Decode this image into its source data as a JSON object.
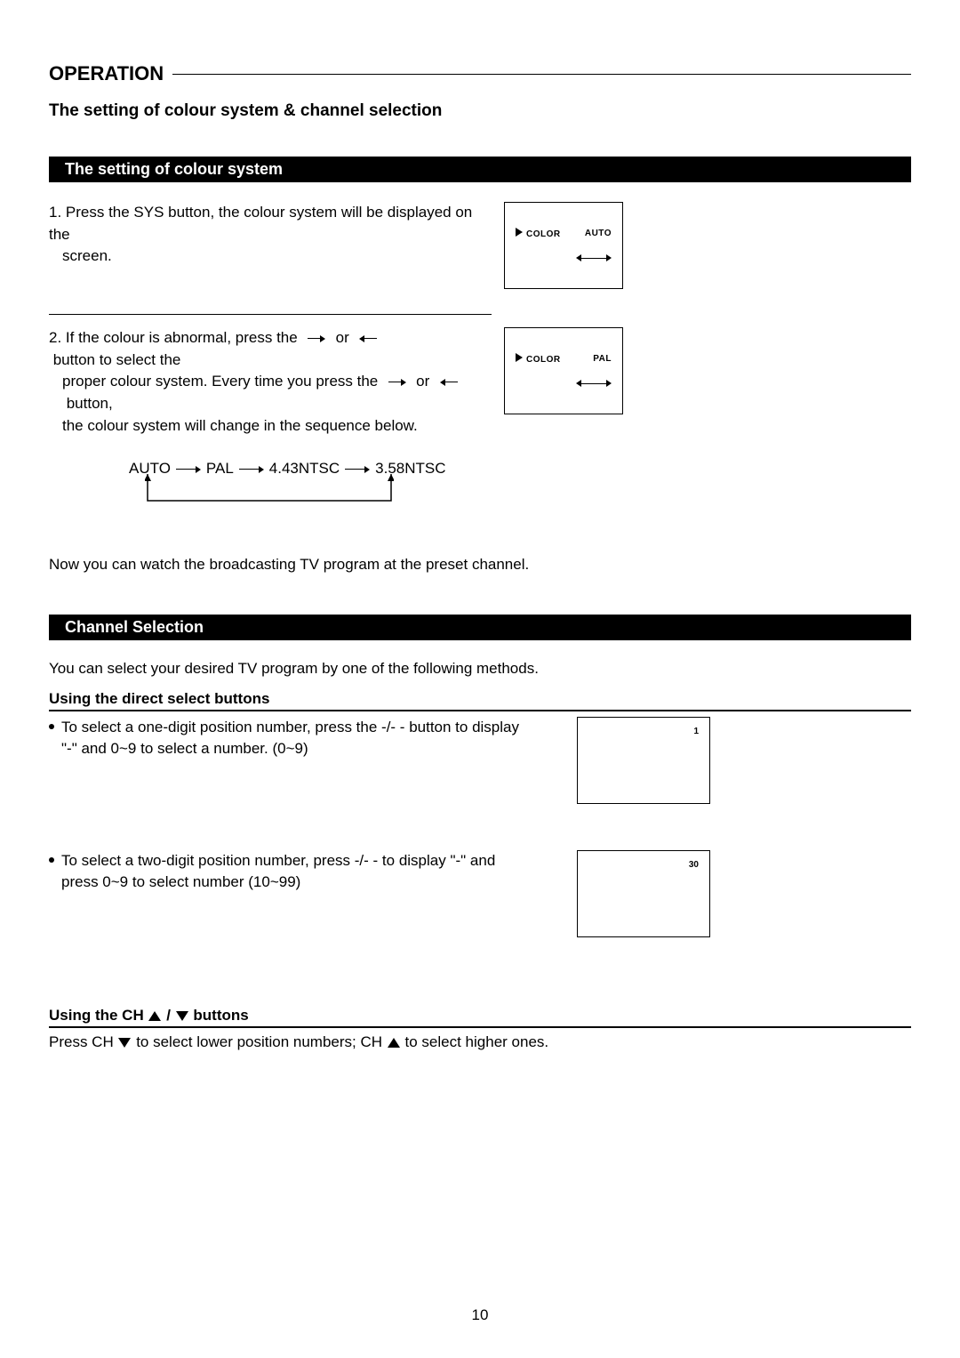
{
  "headings": {
    "operation": "OPERATION",
    "subtitle": "The setting of colour system & channel selection",
    "bar_colour": "The setting of colour system",
    "bar_channel": "Channel Selection"
  },
  "colour": {
    "step1_a": "1. Press the SYS button, the colour system will be displayed on the",
    "step1_b": "screen.",
    "step2_a": "2. If the colour is abnormal, press the ",
    "step2_b": " or ",
    "step2_c": " button to select the",
    "step2_d": "proper colour system. Every time you press the ",
    "step2_e": " or ",
    "step2_f": " button,",
    "step2_g": "the colour system will change in the sequence below.",
    "seq": {
      "a": "AUTO",
      "b": "PAL",
      "c": "4.43NTSC",
      "d": "3.58NTSC"
    },
    "after": "Now you can watch the broadcasting TV program at the preset channel."
  },
  "osd": {
    "color_label": "COLOR",
    "auto": "AUTO",
    "pal": "PAL",
    "num1": "1",
    "num30": "30"
  },
  "channel": {
    "intro": "You can select your desired TV program by one of the following methods.",
    "direct_title": "Using the direct select buttons",
    "bullet1_a": "To select a one-digit position number, press the -/- - button to display",
    "bullet1_b": "\"-\" and 0~9 to select a number. (0~9)",
    "bullet2_a": "To select a two-digit position number, press -/- - to display \"-\" and",
    "bullet2_b": "press 0~9 to select number (10~99)",
    "ch_title_a": "Using the CH",
    "ch_title_b": "/",
    "ch_title_c": "buttons",
    "ch_desc_a": "Press CH",
    "ch_desc_b": " to select lower position numbers; CH",
    "ch_desc_c": " to select higher ones."
  },
  "page_number": "10"
}
